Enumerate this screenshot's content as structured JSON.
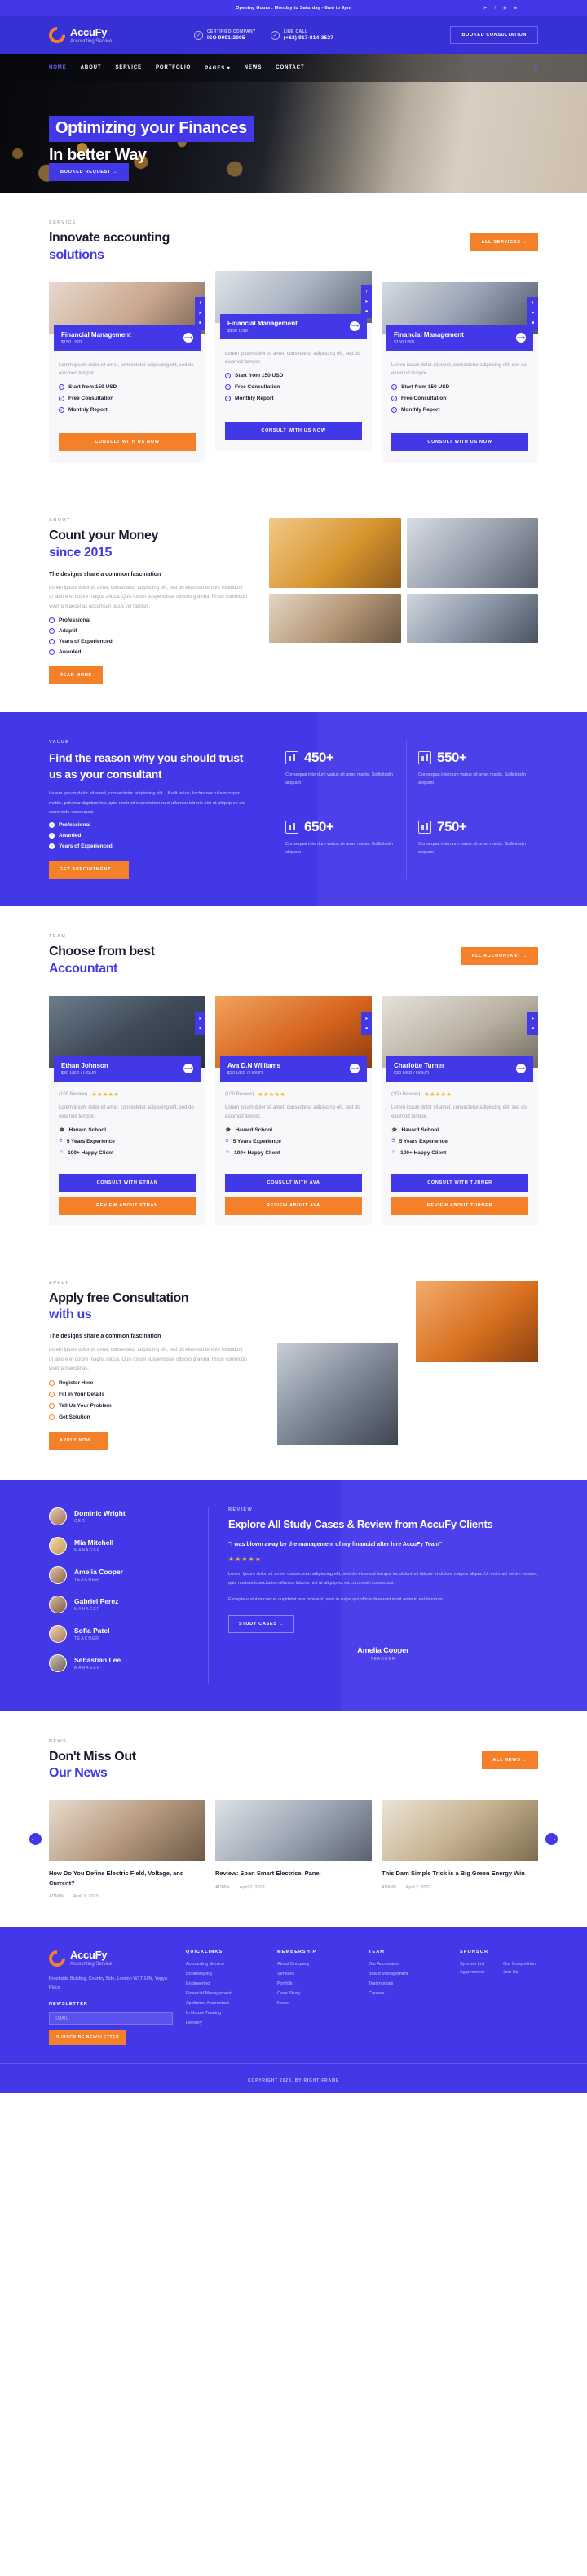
{
  "topbar": {
    "hours": "Opening Hours : Monday to Saturday - 8am to 9pm",
    "socials": [
      "twitter-icon",
      "facebook-icon",
      "instagram-icon",
      "linkedin-icon"
    ]
  },
  "header": {
    "logo_name": "AccuFy",
    "logo_sub": "Accounting Service",
    "info": [
      {
        "label": "CERTIFIED COMPANY",
        "value": "ISO 9001:2005"
      },
      {
        "label": "LINE CALL",
        "value": "(+62) 917-814-3527"
      }
    ],
    "cta": "BOOKED CONSULTATION"
  },
  "nav": {
    "items": [
      {
        "label": "HOME",
        "active": true
      },
      {
        "label": "ABOUT",
        "active": false
      },
      {
        "label": "SERVICE",
        "active": false
      },
      {
        "label": "PORTFOLIO",
        "active": false
      },
      {
        "label": "PAGES",
        "active": false,
        "caret": true
      },
      {
        "label": "NEWS",
        "active": false
      },
      {
        "label": "CONTACT",
        "active": false
      }
    ],
    "search_icon": "search-icon"
  },
  "hero": {
    "line1": "Optimizing your Finances",
    "line2": "In better Way",
    "cta": "BOOKED REQUEST  →"
  },
  "services": {
    "eyebrow": "SERVICE",
    "title_line1": "Innovate accounting",
    "title_line2": "solutions",
    "all_button": "ALL SERVICES  →",
    "cards": [
      {
        "title": "Financial Management",
        "price": "$150 USD",
        "desc": "Lorem ipsum dolor sit amet, consectetur adipiscing elit, sed do eiusmod tempor.",
        "features": [
          "Start from 150 USD",
          "Free Consultation",
          "Monthly Report"
        ],
        "cta": "CONSULT WITH US NOW",
        "cta_style": "orange"
      },
      {
        "title": "Financial Management",
        "price": "$150 USD",
        "desc": "Lorem ipsum dolor sit amet, consectetur adipiscing elit, sed do eiusmod tempor.",
        "features": [
          "Start from 150 USD",
          "Free Consultation",
          "Monthly Report"
        ],
        "cta": "CONSULT WITH US NOW",
        "cta_style": "blue"
      },
      {
        "title": "Financial Management",
        "price": "$150 USD",
        "desc": "Lorem ipsum dolor sit amet, consectetur adipiscing elit, sed do eiusmod tempor.",
        "features": [
          "Start from 150 USD",
          "Free Consultation",
          "Monthly Report"
        ],
        "cta": "CONSULT WITH US NOW",
        "cta_style": "blue"
      }
    ]
  },
  "about": {
    "eyebrow": "ABOUT",
    "title_line1": "Count your Money",
    "title_line2": "since 2015",
    "lead": "The designs share a common fascination",
    "body": "Lorem ipsum dolor sit amet, consectetur adipiscing elit, sed do eiusmod tempor incididunt ut labore et dolore magna aliqua. Quis ipsum suspendisse ultrices gravida. Risus commodo viverra maecenas accumsan lacus vel facilisis.",
    "features": [
      "Professional",
      "Adaptif",
      "Years of Experienced",
      "Awarded"
    ],
    "cta": "READ MORE"
  },
  "value": {
    "eyebrow": "VALUE",
    "title": "Find the reason why you should trust us as your consultant",
    "body": "Lorem ipsum dolor sit amet, consectetur adipiscing elit. Ut elit tellus, luctus nec ullamcorper mattis, pulvinar dapibus leo, quis nostrud exercitation nosi ullamco laboris nisi ut aliquip ex ea commodo consequat.",
    "features": [
      "Professional",
      "Awarded",
      "Years of Experienced"
    ],
    "cta": "GET APPOINTMENT  →",
    "stats": [
      {
        "number": "450+",
        "desc": "Consequat interdum varius sit amet mattis. Sollicitudin aliquam",
        "icon": "chart-money-icon"
      },
      {
        "number": "550+",
        "desc": "Consequat interdum varius sit amet mattis. Sollicitudin aliquam",
        "icon": "clipboard-money-icon"
      },
      {
        "number": "650+",
        "desc": "Consequat interdum varius sit amet mattis. Sollicitudin aliquam",
        "icon": "consultant-icon"
      },
      {
        "number": "750+",
        "desc": "Consequat interdum varius sit amet mattis. Sollicitudin aliquam",
        "icon": "invoice-icon"
      }
    ]
  },
  "team": {
    "eyebrow": "TEAM",
    "title_line1": "Choose from best",
    "title_line2": "Accountant",
    "all_button": "ALL ACCOUNTANT  →",
    "members": [
      {
        "name": "Ethan Johnson",
        "rate": "$30 USD / HOUR",
        "review_count": "(100 Review)",
        "stars": "★★★★★",
        "desc": "Lorem ipsum dolor sit amet, consectetur adipiscing elit, sed do eiusmod tempor.",
        "facts": [
          "Havard School",
          "5 Years Experience",
          "100+ Happy Client"
        ],
        "cta_primary": "CONSULT WITH ETHAN",
        "cta_secondary": "REVIEW ABOUT ETHAN"
      },
      {
        "name": "Ava D.N Williams",
        "rate": "$30 USD / HOUR",
        "review_count": "(100 Review)",
        "stars": "★★★★★",
        "desc": "Lorem ipsum dolor sit amet, consectetur adipiscing elit, sed do eiusmod tempor.",
        "facts": [
          "Havard School",
          "5 Years Experience",
          "100+ Happy Client"
        ],
        "cta_primary": "CONSULT WITH AVA",
        "cta_secondary": "REVIEW ABOUT AVA"
      },
      {
        "name": "Charlotte Turner",
        "rate": "$30 USD / HOUR",
        "review_count": "(100 Review)",
        "stars": "★★★★★",
        "desc": "Lorem ipsum dolor sit amet, consectetur adipiscing elit, sed do eiusmod tempor.",
        "facts": [
          "Havard School",
          "5 Years Experience",
          "100+ Happy Client"
        ],
        "cta_primary": "CONSULT WITH TURNER",
        "cta_secondary": "REVIEW ABOUT TURNER"
      }
    ]
  },
  "consult": {
    "eyebrow": "APPLY",
    "title_line1": "Apply free Consultation",
    "title_line2": "with us",
    "lead": "The designs share a common fascination",
    "body": "Lorem ipsum dolor sit amet, consectetur adipiscing elit, sed do eiusmod tempor incididunt ut labore et dolore magna aliqua. Quis ipsum suspendisse ultrices gravida. Risus commodo viverra maecenas.",
    "steps": [
      "Register Here",
      "Fill in Your Details",
      "Tell Us Your Problem",
      "Get Solution"
    ],
    "cta": "APPLY NOW  →"
  },
  "review": {
    "eyebrow": "REVIEW",
    "title": "Explore All Study Cases & Review from AccuFy Clients",
    "quote": "\"I was blown away by the management of my financial after hire AccuFy Team\"",
    "stars": "★★★★★",
    "body1": "Lorem ipsum dolor sit amet, consectetur adipiscing elit, sed do eiusmod tempor incididunt uti labore et dolore magna aliqua. Ut enim ad minim veniam, quis nostrud exercitation ullamco laboris nisi ut aliquip ex ea commodo consequat.",
    "body2": "Excepteur sint occaecat cupidatat non proident, sunt in culpa qui officia deserunt molit anim id est laborum.",
    "cta": "STUDY CASES  →",
    "author_name": "Amelia Cooper",
    "author_role": "TEACHER",
    "people": [
      {
        "name": "Dominic Wright",
        "role": "CEO"
      },
      {
        "name": "Mia Mitchell",
        "role": "MANAGER"
      },
      {
        "name": "Amelia Cooper",
        "role": "TEACHER"
      },
      {
        "name": "Gabriel Perez",
        "role": "MANAGER"
      },
      {
        "name": "Sofia Patel",
        "role": "TEACHER"
      },
      {
        "name": "Sebastian Lee",
        "role": "MANAGER"
      }
    ]
  },
  "news": {
    "eyebrow": "NEWS",
    "title_line1": "Don't Miss Out",
    "title_line2": "Our News",
    "all_button": "ALL NEWS  →",
    "posts": [
      {
        "title": "How Do You Define Electric Field, Voltage, and Current?",
        "author": "ADMIN",
        "date": "April 2, 2023"
      },
      {
        "title": "Review: Span Smart Electrical Panel",
        "author": "ADMIN",
        "date": "April 2, 2023"
      },
      {
        "title": "This Dam Simple Trick is a Big Green Energy Win",
        "author": "ADMIN",
        "date": "April 2, 2023"
      }
    ],
    "prev_icon": "chevron-left-icon",
    "next_icon": "chevron-right-icon"
  },
  "footer": {
    "logo_name": "AccuFy",
    "logo_sub": "Accounting Service",
    "desc": "Brookside Building, Country Side, London W1T 1FN, Yogya Place",
    "newsletter_label": "NEWSLETTER",
    "newsletter_placeholder": "EMAIL",
    "subscribe": "SUBSCRIBE NEWSLETTER",
    "columns": [
      {
        "heading": "QUICKLINKS",
        "items": [
          "Accounting Service",
          "Bookkeeping",
          "Engineering",
          "Financial Management",
          "Appliance Accountant",
          "In House Training",
          "Delivery"
        ]
      },
      {
        "heading": "MEMBERSHIP",
        "items": [
          "About Company",
          "Services",
          "Portfolio",
          "Case Study",
          "News"
        ]
      },
      {
        "heading": "TEAM",
        "items": [
          "Our Accountant",
          "Board Management",
          "Testimonials",
          "Careers"
        ]
      }
    ],
    "sponsor_heading": "SPONSOR",
    "sponsors": [
      "Sponsor List",
      "Our Competition",
      "Aggreement",
      "Join Us"
    ],
    "copyright": "COPYRIGHT 2023. BY RIGHT FRAME"
  }
}
